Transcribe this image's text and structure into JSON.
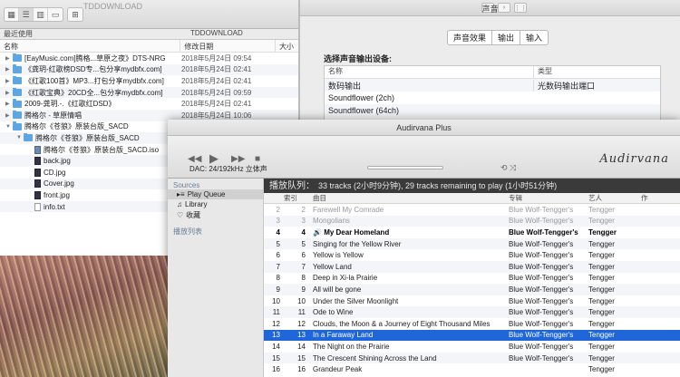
{
  "finder": {
    "path": "TDDOWNLOAD",
    "recent_label": "最近使用",
    "crumb": "TDDOWNLOAD",
    "col_name": "名称",
    "col_date": "修改日期",
    "col_size": "大小",
    "rows": [
      {
        "name": "[EayMusic.com]腾格...草原之夜》DTS-NRG",
        "date": "2018年5月24日 09:54",
        "type": "folder",
        "indent": 0,
        "tri": "▶"
      },
      {
        "name": "《龚玥-红歌榜DSD专...包分享mydbfx.com]",
        "date": "2018年5月24日 02:41",
        "type": "folder",
        "indent": 0,
        "tri": "▶"
      },
      {
        "name": "《红歌100首》MP3...打包分享mydbfx.com]",
        "date": "2018年5月24日 02:41",
        "type": "folder",
        "indent": 0,
        "tri": "▶"
      },
      {
        "name": "《红歌宝典》20CD全...包分享mydbfx.com]",
        "date": "2018年5月24日 09:59",
        "type": "folder",
        "indent": 0,
        "tri": "▶"
      },
      {
        "name": "2009-龚玥.-.《红歌红DSD》",
        "date": "2018年5月24日 02:41",
        "type": "folder",
        "indent": 0,
        "tri": "▶"
      },
      {
        "name": "腾格尔 - 草原情唱",
        "date": "2018年5月24日 10:06",
        "type": "folder",
        "indent": 0,
        "tri": "▶"
      },
      {
        "name": "腾格尔《苍狼》原装台版_SACD",
        "date": "",
        "type": "folder",
        "indent": 0,
        "tri": "▼"
      },
      {
        "name": "腾格尔《苍狼》原装台版_SACD",
        "date": "",
        "type": "folder",
        "indent": 1,
        "tri": "▼"
      },
      {
        "name": "腾格尔《苍狼》原装台版_SACD.iso",
        "date": "",
        "type": "sacd",
        "indent": 2,
        "tri": ""
      },
      {
        "name": "back.jpg",
        "date": "",
        "type": "img",
        "indent": 2,
        "tri": ""
      },
      {
        "name": "CD.jpg",
        "date": "",
        "type": "img",
        "indent": 2,
        "tri": ""
      },
      {
        "name": "Cover.jpg",
        "date": "",
        "type": "img",
        "indent": 2,
        "tri": ""
      },
      {
        "name": "front.jpg",
        "date": "",
        "type": "img",
        "indent": 2,
        "tri": ""
      },
      {
        "name": "info.txt",
        "date": "",
        "type": "txt",
        "indent": 2,
        "tri": ""
      }
    ]
  },
  "prefs": {
    "title": "声音",
    "tabs": [
      "声音效果",
      "输出",
      "输入"
    ],
    "section": "选择声音输出设备:",
    "col_name": "名称",
    "col_type": "类型",
    "devices": [
      {
        "name": "数码输出",
        "type": "光数码输出端口"
      },
      {
        "name": "Soundflower (2ch)",
        "type": ""
      },
      {
        "name": "Soundflower (64ch)",
        "type": ""
      }
    ]
  },
  "audirvana": {
    "title": "Audirvana Plus",
    "logo": "Audirvana",
    "dac": "DAC: 24/192kHz 立体声",
    "sidebar": {
      "sources_label": "Sources",
      "items": [
        "Play Queue",
        "Library",
        "收藏"
      ],
      "playlists_label": "播放列表"
    },
    "queue_title": "播放队列：",
    "queue_info": "33 tracks (2小时9分钟), 29 tracks remaining to play (1小时51分钟)",
    "columns": [
      "",
      "索引",
      "曲目",
      "专辑",
      "艺人",
      "作"
    ],
    "tracks": [
      {
        "n": "2",
        "idx": "2",
        "title": "Farewell My Comrade",
        "album": "Blue Wolf-Tengger's",
        "artist": "Tengger",
        "state": "dim"
      },
      {
        "n": "3",
        "idx": "3",
        "title": "Mongolians",
        "album": "Blue Wolf-Tengger's",
        "artist": "Tengger",
        "state": "dim"
      },
      {
        "n": "4",
        "idx": "4",
        "title": "My Dear Homeland",
        "album": "Blue Wolf-Tengger's",
        "artist": "Tengger",
        "state": "cur"
      },
      {
        "n": "5",
        "idx": "5",
        "title": "Singing for the Yellow River",
        "album": "Blue Wolf-Tengger's",
        "artist": "Tengger",
        "state": ""
      },
      {
        "n": "6",
        "idx": "6",
        "title": "Yellow is Yellow",
        "album": "Blue Wolf-Tengger's",
        "artist": "Tengger",
        "state": ""
      },
      {
        "n": "7",
        "idx": "7",
        "title": "Yellow Land",
        "album": "Blue Wolf-Tengger's",
        "artist": "Tengger",
        "state": ""
      },
      {
        "n": "8",
        "idx": "8",
        "title": "Deep in Xi-la Prairie",
        "album": "Blue Wolf-Tengger's",
        "artist": "Tengger",
        "state": ""
      },
      {
        "n": "9",
        "idx": "9",
        "title": "All will be gone",
        "album": "Blue Wolf-Tengger's",
        "artist": "Tengger",
        "state": ""
      },
      {
        "n": "10",
        "idx": "10",
        "title": "Under the Silver Moonlight",
        "album": "Blue Wolf-Tengger's",
        "artist": "Tengger",
        "state": ""
      },
      {
        "n": "11",
        "idx": "11",
        "title": "Ode to Wine",
        "album": "Blue Wolf-Tengger's",
        "artist": "Tengger",
        "state": ""
      },
      {
        "n": "12",
        "idx": "12",
        "title": "Clouds, the Moon & a Journey of Eight Thousand Miles",
        "album": "Blue Wolf-Tengger's",
        "artist": "Tengger",
        "state": ""
      },
      {
        "n": "13",
        "idx": "13",
        "title": "In a Faraway Land",
        "album": "Blue Wolf-Tengger's",
        "artist": "Tengger",
        "state": "sel"
      },
      {
        "n": "14",
        "idx": "14",
        "title": "The Night on the Prairie",
        "album": "Blue Wolf-Tengger's",
        "artist": "Tengger",
        "state": ""
      },
      {
        "n": "15",
        "idx": "15",
        "title": "The Crescent Shining Across the Land",
        "album": "Blue Wolf-Tengger's",
        "artist": "Tengger",
        "state": ""
      },
      {
        "n": "16",
        "idx": "16",
        "title": "Grandeur Peak",
        "album": "",
        "artist": "Tengger",
        "state": ""
      }
    ]
  }
}
